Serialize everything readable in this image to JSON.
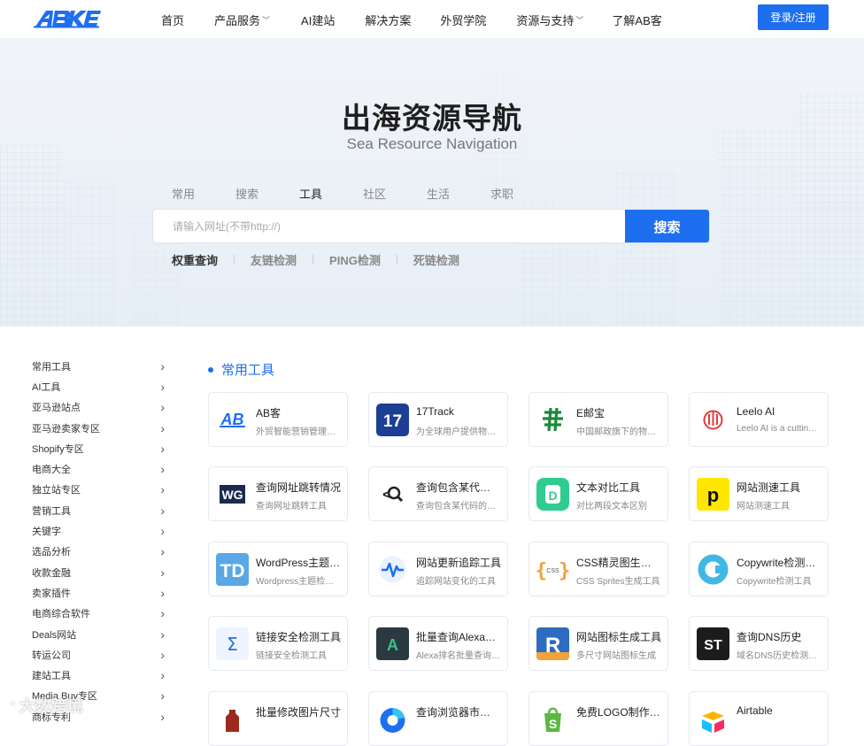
{
  "header": {
    "logo_text": "ABKE",
    "nav": [
      {
        "label": "首页",
        "dropdown": false
      },
      {
        "label": "产品服务",
        "dropdown": true
      },
      {
        "label": "AI建站",
        "dropdown": false
      },
      {
        "label": "解决方案",
        "dropdown": false
      },
      {
        "label": "外贸学院",
        "dropdown": false
      },
      {
        "label": "资源与支持",
        "dropdown": true
      },
      {
        "label": "了解AB客",
        "dropdown": false
      }
    ],
    "login_label": "登录/注册"
  },
  "hero": {
    "title": "出海资源导航",
    "subtitle": "Sea Resource Navigation",
    "tabs": [
      "常用",
      "搜索",
      "工具",
      "社区",
      "生活",
      "求职"
    ],
    "active_tab": "工具",
    "search": {
      "placeholder": "请输入网址(不带http://)",
      "value": "",
      "button": "搜索"
    },
    "sub_tabs": [
      "权重查询",
      "友链检测",
      "PING检测",
      "死链检测"
    ]
  },
  "sidebar": {
    "items": [
      "常用工具",
      "AI工具",
      "亚马逊站点",
      "亚马逊卖家专区",
      "Shopify专区",
      "电商大全",
      "独立站专区",
      "营销工具",
      "关键字",
      "选品分析",
      "收款金融",
      "卖家插件",
      "电商综合软件",
      "Deals网站",
      "转运公司",
      "建站工具",
      "Media Buy专区",
      "商标专利"
    ]
  },
  "main": {
    "section_title": "常用工具",
    "cards": [
      {
        "name": "AB客",
        "desc": "外贸智能营销管理平台",
        "icon": "abke-logo-icon"
      },
      {
        "name": "17Track",
        "desc": "为全球用户提供物流查询",
        "icon": "17track-icon"
      },
      {
        "name": "E邮宝",
        "desc": "中国邮政旗下的物流服务",
        "icon": "china-post-icon"
      },
      {
        "name": "Leelo AI",
        "desc": "Leelo AI is a cutting-edge",
        "icon": "leelo-ai-icon"
      },
      {
        "name": "查询网址跳转情况",
        "desc": "查询网址跳转工具",
        "icon": "redirect-check-icon"
      },
      {
        "name": "查询包含某代码的网站",
        "desc": "查询包含某代码的网站",
        "icon": "code-search-icon"
      },
      {
        "name": "文本对比工具",
        "desc": "对比两段文本区别",
        "icon": "text-diff-icon"
      },
      {
        "name": "网站测速工具",
        "desc": "网站测速工具",
        "icon": "speed-test-icon"
      },
      {
        "name": "WordPress主题检测",
        "desc": "Wordpress主题检测工具",
        "icon": "wordpress-detect-icon"
      },
      {
        "name": "网站更新追踪工具",
        "desc": "追踪网站变化的工具",
        "icon": "site-tracker-icon"
      },
      {
        "name": "CSS精灵图生成器",
        "desc": "CSS Sprites生成工具",
        "icon": "css-sprite-icon"
      },
      {
        "name": "Copywrite检测工具",
        "desc": "Copywrite检测工具",
        "icon": "copywrite-icon"
      },
      {
        "name": "链接安全检测工具",
        "desc": "链接安全检测工具",
        "icon": "link-safety-icon"
      },
      {
        "name": "批量查询Alexa排名",
        "desc": "Alexa排名批量查询工具",
        "icon": "alexa-icon"
      },
      {
        "name": "网站图标生成工具",
        "desc": "多尺寸网站图标生成",
        "icon": "favicon-generator-icon"
      },
      {
        "name": "查询DNS历史",
        "desc": "域名DNS历史检测工具",
        "icon": "dns-history-icon"
      },
      {
        "name": "批量修改图片尺寸",
        "desc": "",
        "icon": "image-resize-icon"
      },
      {
        "name": "查询浏览器市场份额",
        "desc": "",
        "icon": "browser-share-icon"
      },
      {
        "name": "免费LOGO制作工具",
        "desc": "",
        "icon": "logo-maker-icon"
      },
      {
        "name": "Airtable",
        "desc": "",
        "icon": "airtable-icon"
      }
    ]
  },
  "watermark": "大数跨境",
  "colors": {
    "accent": "#1e6ff0",
    "hero_bg": "#eef3f8"
  }
}
